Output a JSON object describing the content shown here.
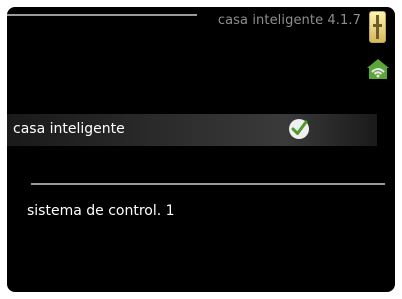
{
  "header": {
    "title": "casa inteligente 4.1.7"
  },
  "icons": {
    "thermometer": "thermometer-icon",
    "home_wifi": "home-wifi-icon",
    "checkmark": "checkmark-icon"
  },
  "menu": {
    "items": [
      {
        "label": "casa inteligente",
        "checked": true
      },
      {
        "label": "sistema de control. 1"
      }
    ]
  },
  "colors": {
    "background": "#000000",
    "text": "#ffffff",
    "title": "#8e8e8e",
    "accent_green": "#5aa63a"
  }
}
